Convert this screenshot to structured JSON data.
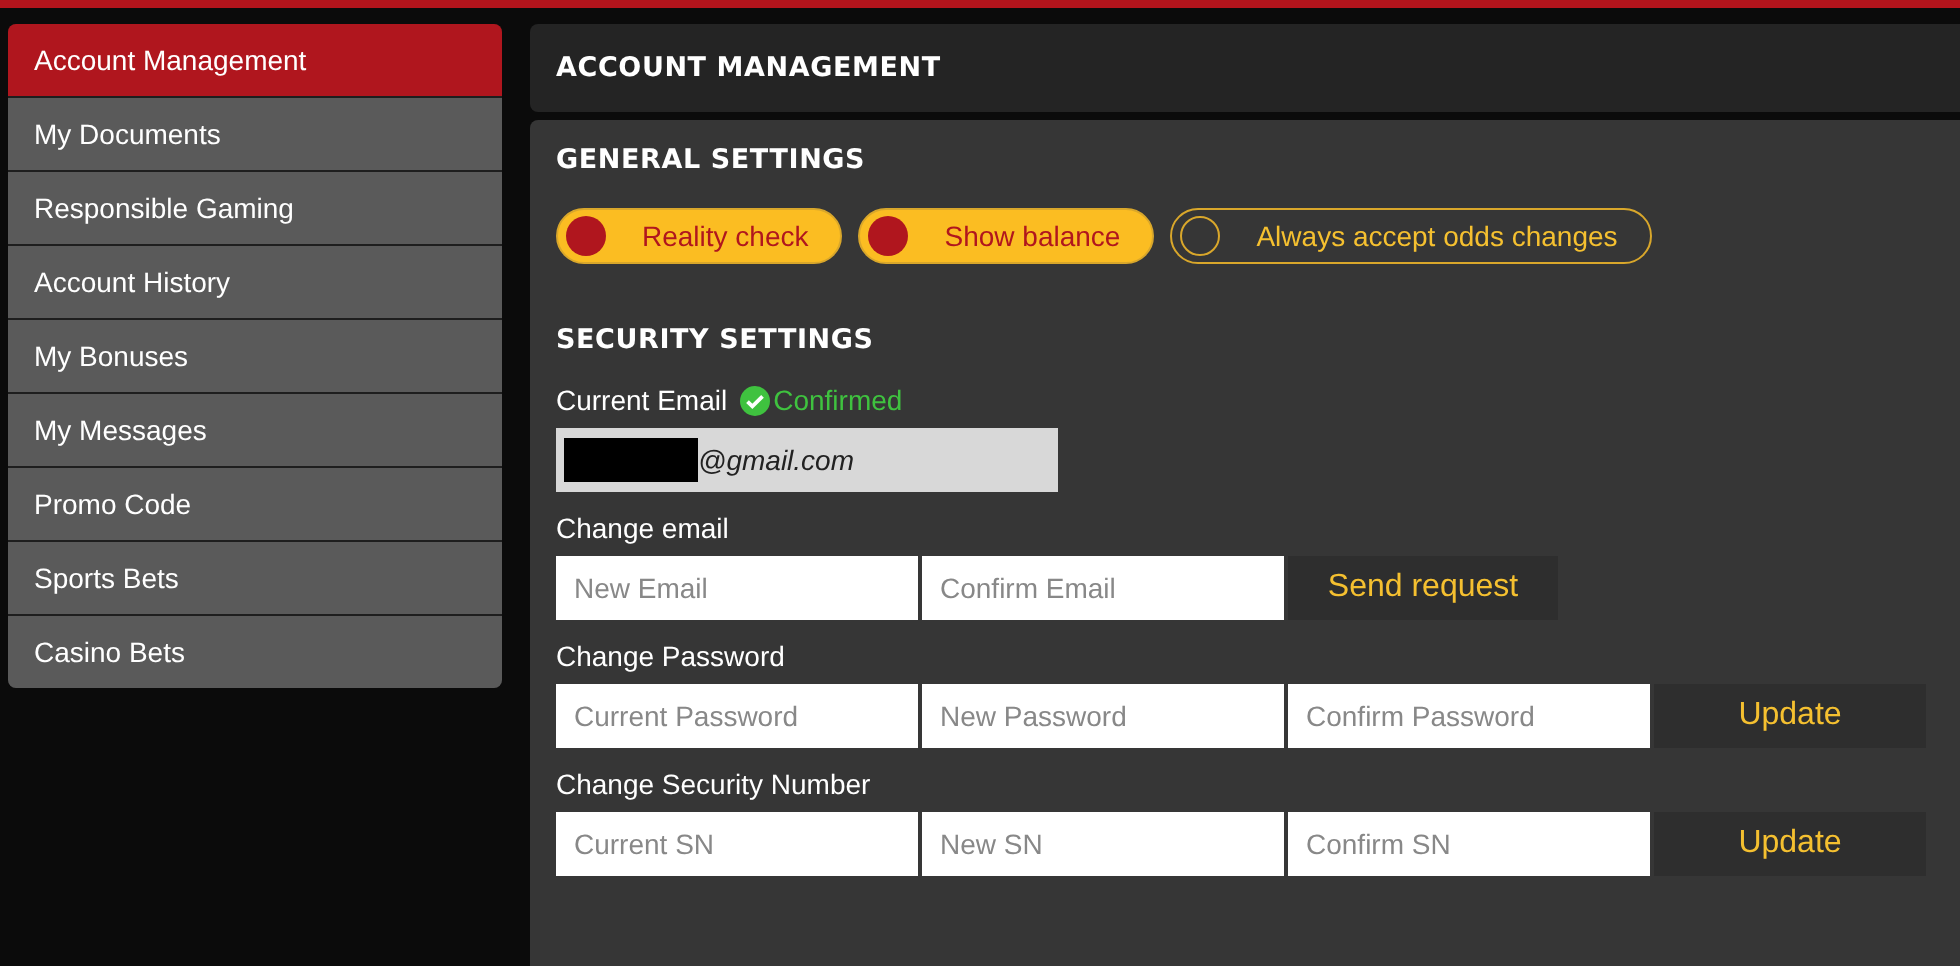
{
  "sidebar": {
    "items": [
      {
        "label": "Account Management",
        "selected": true
      },
      {
        "label": "My Documents",
        "selected": false
      },
      {
        "label": "Responsible Gaming",
        "selected": false
      },
      {
        "label": "Account History",
        "selected": false
      },
      {
        "label": "My Bonuses",
        "selected": false
      },
      {
        "label": "My Messages",
        "selected": false
      },
      {
        "label": "Promo Code",
        "selected": false
      },
      {
        "label": "Sports Bets",
        "selected": false
      },
      {
        "label": "Casino Bets",
        "selected": false
      }
    ]
  },
  "header": {
    "title": "ACCOUNT MANAGEMENT"
  },
  "general_settings": {
    "title": "GENERAL SETTINGS",
    "toggles": [
      {
        "label": "Reality check",
        "on": true
      },
      {
        "label": "Show balance",
        "on": true
      },
      {
        "label": "Always accept odds changes",
        "on": false
      }
    ]
  },
  "security_settings": {
    "title": "SECURITY SETTINGS",
    "current_email": {
      "label": "Current Email",
      "status": "Confirmed",
      "value": "@gmail.com"
    },
    "groups": [
      {
        "label": "Change email",
        "fields": [
          {
            "placeholder": "New Email"
          },
          {
            "placeholder": "Confirm Email"
          }
        ],
        "button": "Send request"
      },
      {
        "label": "Change Password",
        "fields": [
          {
            "placeholder": "Current Password"
          },
          {
            "placeholder": "New Password"
          },
          {
            "placeholder": "Confirm Password"
          }
        ],
        "button": "Update"
      },
      {
        "label": "Change Security Number",
        "fields": [
          {
            "placeholder": "Current SN"
          },
          {
            "placeholder": "New SN"
          },
          {
            "placeholder": "Confirm SN"
          }
        ],
        "button": "Update"
      }
    ]
  }
}
